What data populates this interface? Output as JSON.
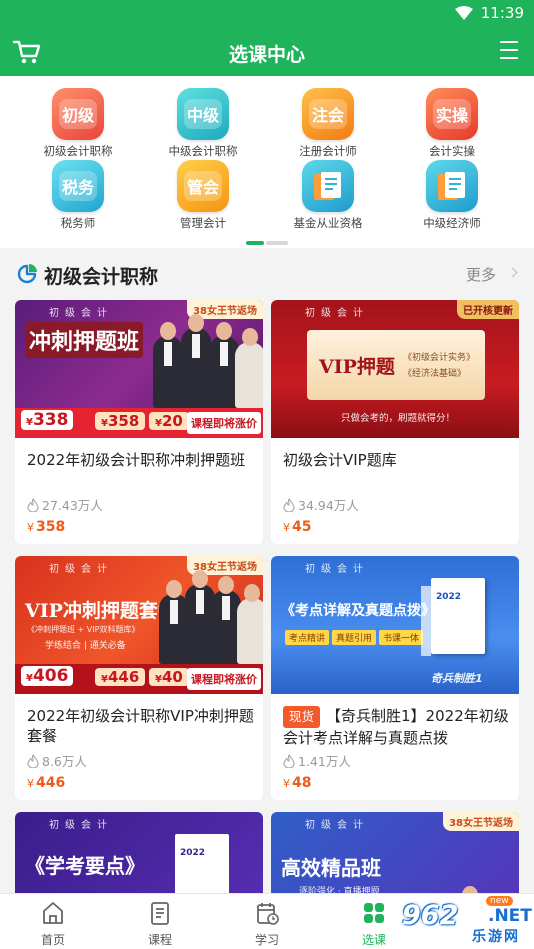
{
  "status_bar": {
    "time": "11:39"
  },
  "app_bar": {
    "title": "选课中心"
  },
  "categories": [
    {
      "label": "初级会计职称",
      "icon_text": "初级",
      "color": "#f06a4a"
    },
    {
      "label": "中级会计职称",
      "icon_text": "中级",
      "color": "#2ec6c4"
    },
    {
      "label": "注册会计师",
      "icon_text": "注会",
      "color": "#ff9a1e"
    },
    {
      "label": "会计实操",
      "icon_text": "实操",
      "color": "#f0583a"
    },
    {
      "label": "税务师",
      "icon_text": "税务",
      "color": "#2fc1d6"
    },
    {
      "label": "管理会计",
      "icon_text": "管会",
      "color": "#ffa51a"
    },
    {
      "label": "基金从业资格",
      "icon_text": "",
      "color": "#2fb3d6"
    },
    {
      "label": "中级经济师",
      "icon_text": "",
      "color": "#2fb3d6"
    }
  ],
  "section": {
    "title": "初级会计职称",
    "more_label": "更多"
  },
  "courses": [
    {
      "name": "2022年初级会计职称冲刺押题班",
      "tag": "",
      "views": "27.43万人",
      "currency": "¥",
      "price": "358",
      "banner": {
        "top": "初级会计",
        "big": "冲刺押题班",
        "sub": "",
        "ribbon": "38女王节返场",
        "price_old": "338",
        "price_a": "358",
        "price_b": "20",
        "promo": "课程即将涨价"
      }
    },
    {
      "name": "初级会计VIP题库",
      "tag": "",
      "views": "34.94万人",
      "currency": "¥",
      "price": "45",
      "banner": {
        "top": "初级会计",
        "big": "VIP押题",
        "book1": "《初级会计实务》",
        "book2": "《经济法基础》",
        "strip": "只做会考的，刷题就得分！",
        "ribbon": "已开核更新"
      }
    },
    {
      "name": "2022年初级会计职称VIP冲刺押题套餐",
      "tag": "",
      "views": "8.6万人",
      "currency": "¥",
      "price": "446",
      "banner": {
        "top": "初级会计",
        "big": "VIP冲刺押题套餐",
        "sub": "《冲刺押题班 + VIP双科题库》",
        "sub2": "学练结合 | 通关必备",
        "ribbon": "38女王节返场",
        "price_old": "406",
        "price_a": "446",
        "price_b": "40",
        "promo": "课程即将涨价"
      }
    },
    {
      "name": "【奇兵制胜1】2022年初级会计考点详解与真题点拨",
      "tag": "现货",
      "views": "1.41万人",
      "currency": "¥",
      "price": "48",
      "banner": {
        "top": "初级会计",
        "big": "《考点详解及真题点拨》",
        "pills": [
          "考点精讲",
          "真题引用",
          "书课一体"
        ],
        "book_year": "2022",
        "brand": "奇兵制胜1"
      }
    },
    {
      "name": "",
      "banner": {
        "top": "初级会计",
        "big": "《学考要点》",
        "book_year": "2022"
      }
    },
    {
      "name": "",
      "banner": {
        "top": "初级会计",
        "big": "高效精品班",
        "sub": "逐阶强化 · 直播押题",
        "ribbon": "38女王节返场"
      }
    }
  ],
  "tabs": [
    {
      "label": "首页",
      "active": false
    },
    {
      "label": "课程",
      "active": false
    },
    {
      "label": "学习",
      "active": false
    },
    {
      "label": "选课",
      "active": true
    }
  ],
  "watermark": {
    "logo": "962",
    "net": ".NET",
    "new": "new",
    "sub": "乐游网"
  },
  "colors": {
    "brand_green": "#1fb35b",
    "price_orange": "#f05a1a"
  }
}
